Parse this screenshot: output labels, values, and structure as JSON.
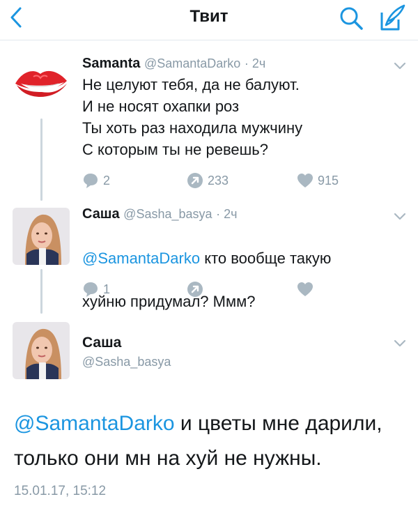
{
  "header": {
    "title": "Твит",
    "accent": "#1b95e0"
  },
  "tweet1": {
    "name": "Samanta",
    "handle": "@SamantaDarko",
    "time": "· 2ч",
    "text": "Не целуют тебя, да не балуют.\nИ не носят охапки роз\nТы хоть раз находила мужчину\nС которым ты не ревешь?",
    "replies": "2",
    "retweets": "233",
    "likes": "915",
    "avatar_icon": "lips-icon"
  },
  "tweet2": {
    "name": "Саша",
    "handle": "@Sasha_basya",
    "time": "· 2ч",
    "mention": "@SamantaDarko",
    "text_line1_rest": " кто вообще такую",
    "text_line2": "хуйню придумал? Ммм?",
    "replies": "1"
  },
  "tweet3": {
    "name": "Саша",
    "handle": "@Sasha_basya",
    "mention": "@SamantaDarko",
    "text_rest": " и цветы мне дарили, только они мн  на хуй не нужны.",
    "timestamp": "15.01.17, 15:12"
  }
}
